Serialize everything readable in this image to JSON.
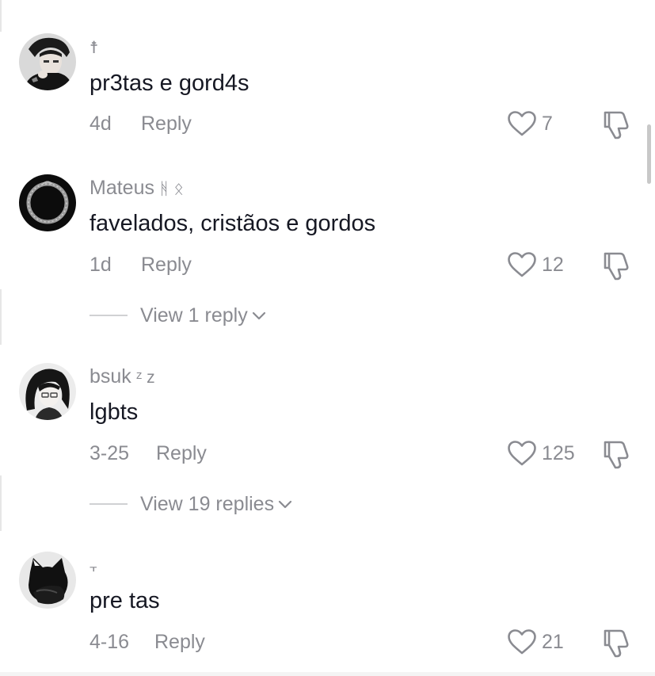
{
  "comments": [
    {
      "username": "",
      "name_deco": "☨",
      "text": "pr3tas e gord4s",
      "date": "4d",
      "reply_label": "Reply",
      "likes": "7",
      "avatar": "photo-boy-icon"
    },
    {
      "username": "Mateus",
      "name_deco": "ᚻ ᛟ",
      "text": "favelados, cristãos e gordos",
      "date": "1d",
      "reply_label": "Reply",
      "likes": "12",
      "view_replies": "View 1 reply",
      "avatar": "ouroboros-icon"
    },
    {
      "username": "bsuk",
      "name_deco": "ᶻ z",
      "text": "lgbts",
      "date": "3-25",
      "reply_label": "Reply",
      "likes": "125",
      "view_replies": "View 19 replies",
      "avatar": "anime-girl-icon"
    },
    {
      "username": "",
      "name_deco": "⫟",
      "text": "pre tas",
      "date": "4-16",
      "reply_label": "Reply",
      "likes": "21",
      "avatar": "black-cat-icon"
    }
  ],
  "colors": {
    "text_primary": "#161823",
    "text_secondary": "#8a8b91",
    "divider": "#d0d1d3"
  }
}
